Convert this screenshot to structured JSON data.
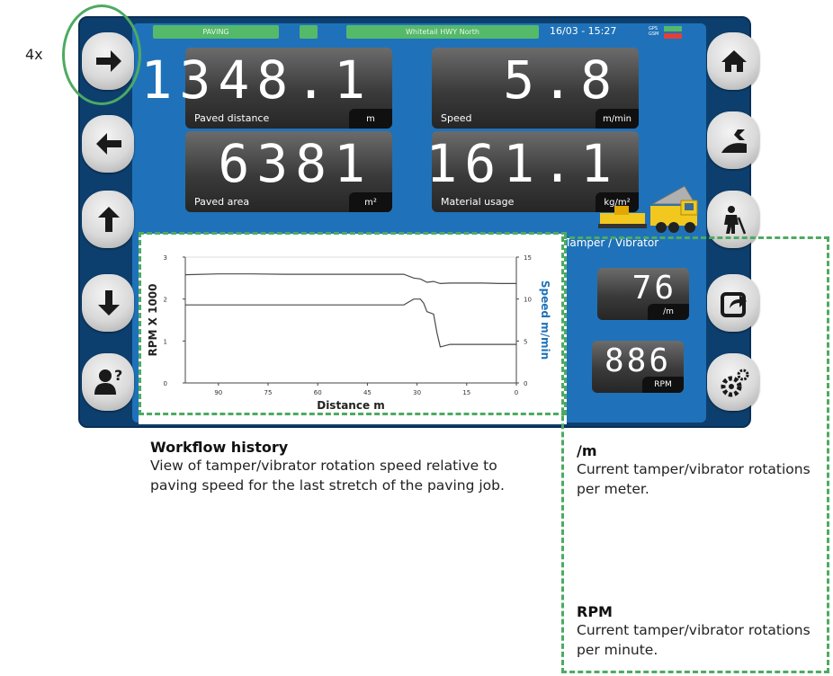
{
  "zoom_label": "4x",
  "status_bar": {
    "mode": "PAVING",
    "road": "Whitetail HWY North",
    "datetime": "16/03 - 15:27",
    "gps_label": "GPS",
    "gsm_label": "GSM"
  },
  "readouts": {
    "paved_distance": {
      "value": "1348.1",
      "label": "Paved distance",
      "unit": "m"
    },
    "speed": {
      "value": "5.8",
      "label": "Speed",
      "unit": "m/min"
    },
    "paved_area": {
      "value": "6381",
      "label": "Paved area",
      "unit": "m²"
    },
    "material_usage": {
      "value": "161.1",
      "label": "Material usage",
      "unit": "kg/m²"
    }
  },
  "tamper": {
    "title": "Tamper / Vibrator",
    "per_meter": {
      "value": "76",
      "unit": "/m"
    },
    "rpm": {
      "value": "886",
      "unit": "RPM"
    }
  },
  "left_buttons": [
    "arrow-right-icon",
    "arrow-left-icon",
    "arrow-up-icon",
    "arrow-down-icon",
    "help-user-icon"
  ],
  "right_buttons": [
    "home-icon",
    "dump-icon",
    "worker-icon",
    "export-icon",
    "settings-icon"
  ],
  "colors": {
    "screen_bg": "#1f72b9",
    "status_green": "#55b96a",
    "annotation_green": "#4daa62",
    "chart_line": "#4a4a4a"
  },
  "chart_data": {
    "type": "line",
    "xlabel": "Distance m",
    "ylabel_left": "RPM X 1000",
    "ylabel_right": "Speed m/min",
    "x_ticks": [
      90,
      75,
      60,
      45,
      30,
      15,
      0
    ],
    "xlim": [
      100,
      0
    ],
    "y_left_ticks": [
      0,
      1,
      2,
      3
    ],
    "ylim_left": [
      0,
      3
    ],
    "y_right_ticks": [
      0,
      5,
      10,
      15
    ],
    "ylim_right": [
      0,
      15
    ],
    "grid": false,
    "series": [
      {
        "axis": "left",
        "x": [
          100,
          90,
          80,
          70,
          60,
          50,
          40,
          34,
          31,
          29,
          27,
          25,
          23,
          20,
          15,
          10,
          5,
          0
        ],
        "values": [
          2.58,
          2.6,
          2.6,
          2.59,
          2.59,
          2.59,
          2.59,
          2.59,
          2.5,
          2.48,
          2.4,
          2.42,
          2.37,
          2.38,
          2.38,
          2.38,
          2.37,
          2.37
        ]
      },
      {
        "axis": "right",
        "x": [
          100,
          90,
          80,
          70,
          60,
          50,
          40,
          34,
          31,
          29,
          28,
          27,
          25,
          24,
          23,
          20,
          10,
          0
        ],
        "values": [
          9.3,
          9.3,
          9.3,
          9.3,
          9.3,
          9.3,
          9.3,
          9.3,
          10.0,
          10.0,
          9.5,
          8.5,
          8.2,
          6.0,
          4.3,
          4.6,
          4.6,
          4.6
        ]
      }
    ]
  },
  "annotations": {
    "workflow": {
      "title": "Workflow history",
      "text": "View of tamper/vibrator rotation speed relative to paving speed for the last stretch of the paving job."
    },
    "per_meter": {
      "title": "/m",
      "text": "Current tamper/vibrator rotations per meter."
    },
    "rpm": {
      "title": "RPM",
      "text": "Current tamper/vibrator rotations per minute."
    }
  }
}
